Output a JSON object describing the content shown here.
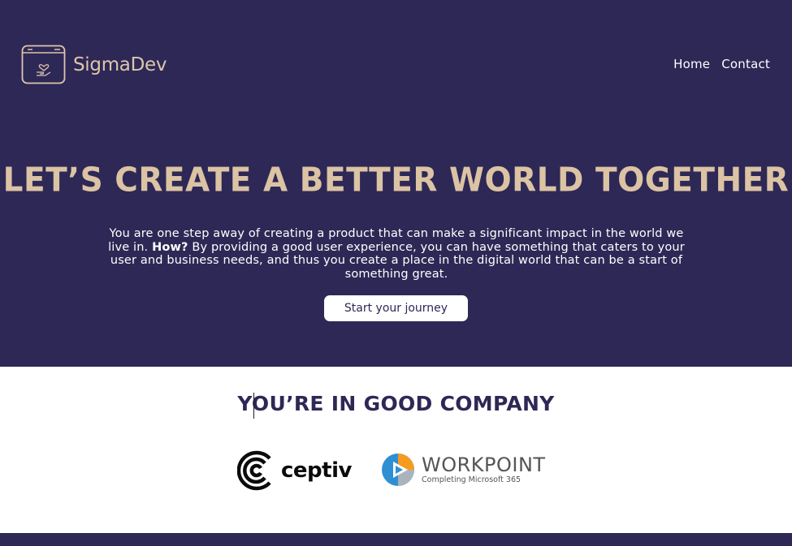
{
  "header": {
    "brand": "SigmaDev",
    "logo_icon": "browser-window-heart-hand-icon",
    "nav": [
      {
        "label": "Home"
      },
      {
        "label": "Contact"
      }
    ]
  },
  "hero": {
    "headline": "Let’s create a better world together",
    "description_before": "You are one step away of creating a product that can make a significant impact in the world we live in. ",
    "description_bold": "How?",
    "description_after": " By providing a good user experience, you can have something that caters to your user and business needs, and thus you create a place in the digital world that can be a start of something great.",
    "cta_label": "Start your journey"
  },
  "clients": {
    "title": "You’re in good company",
    "logos": [
      {
        "name": "ceptiv",
        "icon": "ceptiv-c-logo-icon"
      },
      {
        "name": "WORKPOINT",
        "tagline": "Completing Microsoft 365",
        "icon": "workpoint-play-logo-icon"
      }
    ]
  },
  "colors": {
    "hero_bg": "#2e2856",
    "accent_beige": "#dbc3a4",
    "white": "#ffffff"
  }
}
